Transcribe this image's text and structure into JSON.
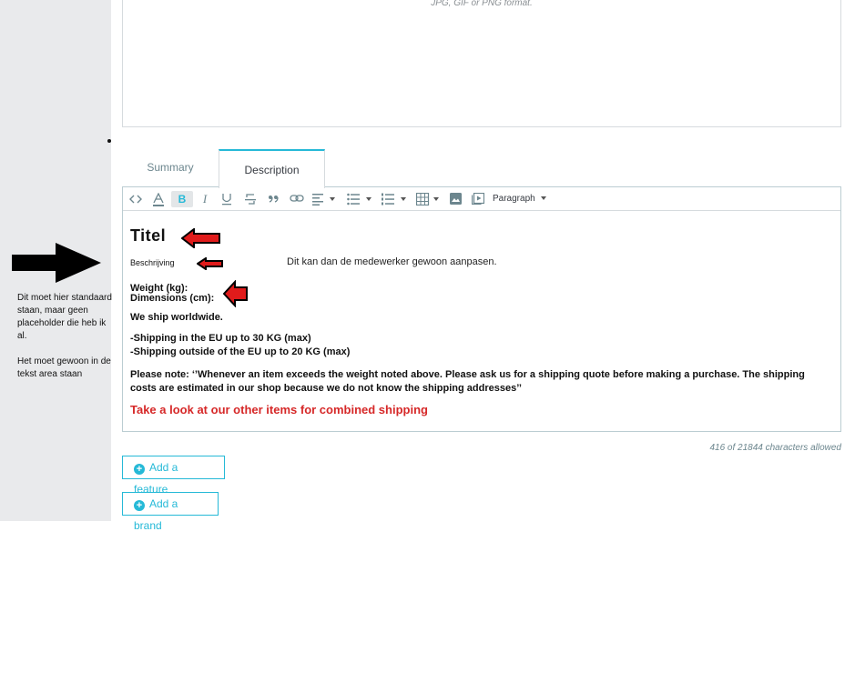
{
  "upload": {
    "hint": "JPG, GIF or PNG format."
  },
  "tabs": [
    {
      "label": "Summary",
      "active": false
    },
    {
      "label": "Description",
      "active": true
    }
  ],
  "toolbar": {
    "format_label": "Paragraph",
    "icons": [
      "code-icon",
      "text-color-icon",
      "bold-icon",
      "italic-icon",
      "underline-icon",
      "strikethrough-icon",
      "blockquote-icon",
      "link-icon",
      "align-icon",
      "bullet-list-icon",
      "numbered-list-icon",
      "table-icon",
      "image-icon",
      "media-icon"
    ]
  },
  "content": {
    "title": "Titel",
    "description": "Beschrijving",
    "inline_note": "Dit kan dan de medewerker gewoon aanpasen.",
    "weight": "Weight (kg):",
    "dimensions": "Dimensions (cm):",
    "ship_worldwide": "We ship worldwide.",
    "shipping_eu": "-Shipping in the EU up to 30 KG (max)",
    "shipping_outside": "-Shipping outside of the EU up to 20 KG (max)",
    "please_note": "Please note: ‘’Whenever an item exceeds the weight noted above. Please ask us for a shipping quote before making a purchase. The shipping costs are estimated in our shop because we do not know the shipping addresses’’",
    "promo": "Take a look at our other items for combined shipping"
  },
  "counter": "416 of 21844 characters allowed",
  "buttons": {
    "add_feature": "Add a feature",
    "add_brand": "Add a brand"
  },
  "side_note": {
    "line1": "Dit moet hier standaard staan, maar geen placeholder die heb ik al.",
    "line2": "Het moet gewoon in de tekst area staan"
  },
  "colors": {
    "accent": "#25b9d7",
    "promo_red": "#d62828",
    "annotation_arrow_red": "#e01b1b"
  }
}
